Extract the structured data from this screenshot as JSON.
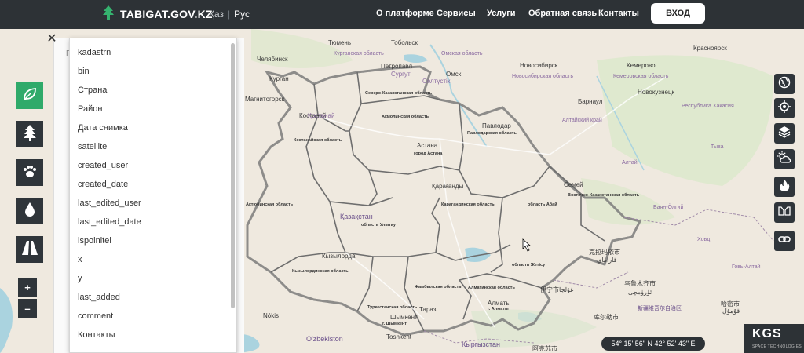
{
  "header": {
    "logo_text": "TABIGAT.GOV.KZ",
    "lang_kaz": "Қаз",
    "lang_rus": "Рус",
    "nav": [
      "О платформе",
      "Сервисы",
      "Услуги",
      "Обратная связь",
      "Контакты"
    ],
    "login_label": "ВХОД"
  },
  "panel": {
    "close_glyph": "✕",
    "tab_partial": "П",
    "dropdown_items": [
      "kadastrn",
      "bin",
      "Страна",
      "Район",
      "Дата снимка",
      "satellite",
      "created_user",
      "created_date",
      "last_edited_user",
      "last_edited_date",
      "ispolnitel",
      "x",
      "y",
      "last_added",
      "comment",
      "Контакты"
    ]
  },
  "left_tools": [
    {
      "name": "leaf-icon",
      "active": true
    },
    {
      "name": "tree-icon",
      "active": false
    },
    {
      "name": "paw-icon",
      "active": false
    },
    {
      "name": "water-drop-icon",
      "active": false
    },
    {
      "name": "road-icon",
      "active": false
    }
  ],
  "zoom": {
    "in": "+",
    "out": "–"
  },
  "right_tools": [
    "globe-icon",
    "locate-icon",
    "layers-icon",
    "weather-icon",
    "fire-icon",
    "compare-icon",
    "link-icon"
  ],
  "coordinates": "54° 15' 56\" N 42° 52' 43\" E",
  "kgs": {
    "logo": "KGS",
    "tagline": "SPACE TECHNOLOGIES"
  },
  "map_labels": {
    "regions": [
      "Северо-Казахстанская область",
      "Костанайская область",
      "Акмолинская область",
      "Павлодарская область",
      "Восточно-Казахстанская область",
      "область Абай",
      "Карагандинская область",
      "Актюбинская область",
      "область Улытау",
      "Кызылординская область",
      "Жамбылская область",
      "Алматинская область",
      "область Жетісу",
      "Туркестанская область",
      "город Астана",
      "г. Шымкент",
      "г. Алматы"
    ],
    "cities": [
      "Петропавл",
      "Омск",
      "Новосибирск",
      "Кемерово",
      "Красноярск",
      "Барнаул",
      "Новокузнецк",
      "Костанай",
      "Астана",
      "Павлодар",
      "Қарағанды",
      "Семей",
      "Қазақстан",
      "Алматы",
      "Тараз",
      "Шымкент",
      "Toshkent",
      "Кызылорда",
      "Nókis",
      "O'zbekiston",
      "Кыргызстан",
      "Курган",
      "Челябинск",
      "Магнитогорск",
      "Тюмень",
      "Тобольск",
      "Сургут",
      "Солтүстік",
      "Қостанай"
    ],
    "foreign": [
      "克拉玛依市",
      "قاراماي",
      "乌鲁木齐市",
      "ئۈرۈمچى",
      "伊宁市",
      "غۇلجا",
      "库尔勒市",
      "新疆维吾尔自治区",
      "哈密市",
      "قۇمۇل",
      "阿克苏市"
    ],
    "oblasts_ru": [
      "Курганская область",
      "Омская область",
      "Новосибирская область",
      "Кемеровская область",
      "Алтайский край",
      "Республика Хакасия",
      "Алтай",
      "Баян-Ӧлгий",
      "Ховд",
      "Говь-Алтай",
      "Тыва"
    ]
  }
}
